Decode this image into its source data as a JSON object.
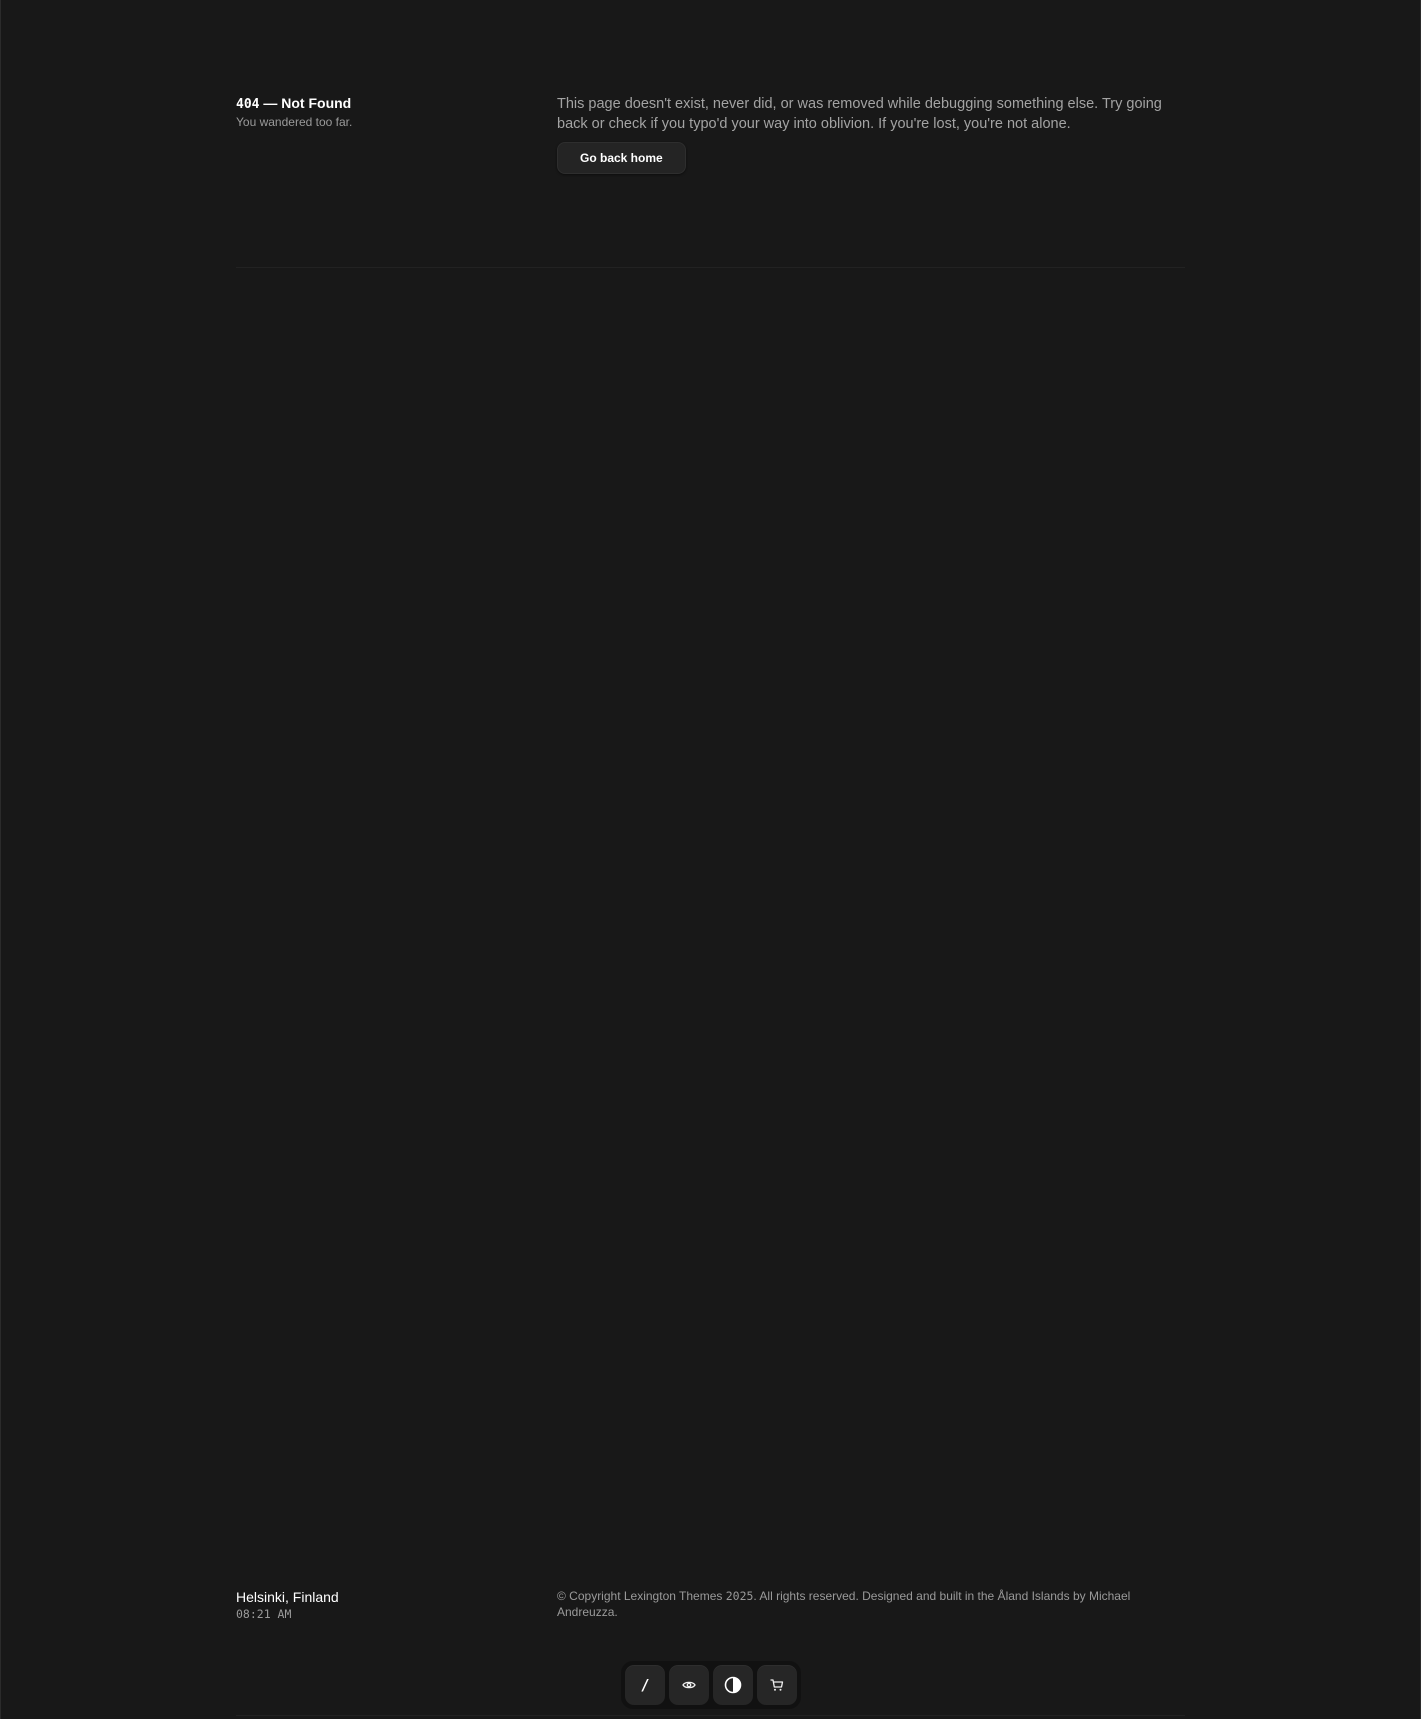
{
  "header": {
    "code": "404",
    "title": " — Not Found",
    "subtitle": "You wandered too far."
  },
  "main": {
    "description": "This page doesn't exist, never did, or was removed while debugging something else. Try going back or check if you typo'd your way into oblivion. If you're lost, you're not alone.",
    "home_button_label": "Go back home"
  },
  "footer": {
    "location": "Helsinki, Finland",
    "time": "08:21 AM",
    "copyright_prefix": "© Copyright Lexington Themes ",
    "copyright_year": "2025",
    "copyright_suffix": ". All rights reserved. Designed and built in the Åland Islands by Michael Andreuzza."
  },
  "dock": {
    "items": [
      {
        "label": "/",
        "icon": "slash-icon"
      },
      {
        "icon": "eye-icon"
      },
      {
        "icon": "contrast-icon"
      },
      {
        "icon": "cart-icon"
      }
    ]
  },
  "colors": {
    "background": "#181818",
    "button": "#242424",
    "dock": "#111111",
    "text_primary": "#ffffff",
    "text_muted": "#9a9a9a"
  }
}
